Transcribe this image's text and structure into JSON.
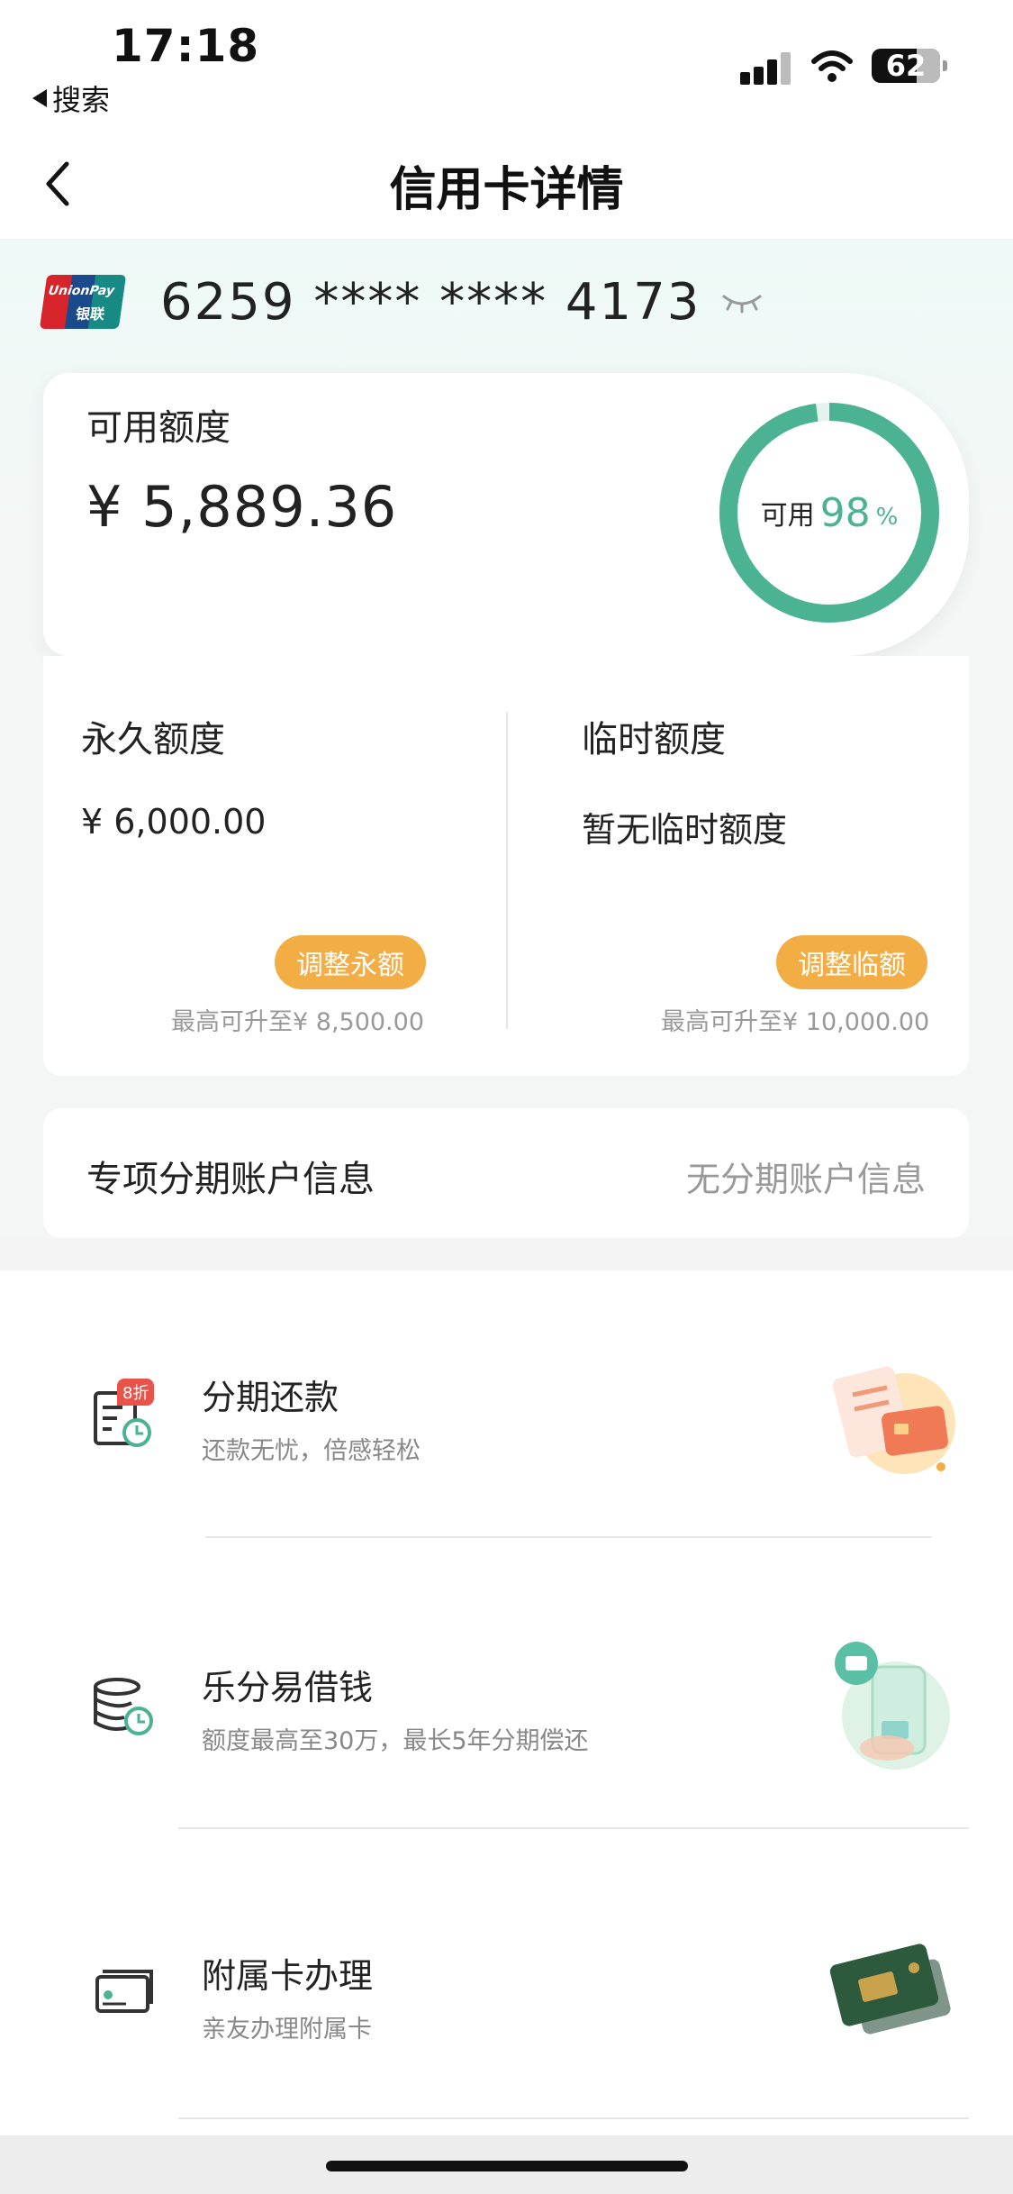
{
  "status_bar": {
    "time": "17:18",
    "back_app": "搜索",
    "battery": "62"
  },
  "nav": {
    "title": "信用卡详情"
  },
  "card": {
    "number": "6259 **** **** 4173",
    "brand_top": "UnionPay",
    "brand_bottom": "银联"
  },
  "available": {
    "label": "可用额度",
    "amount": "¥ 5,889.36",
    "ring_label": "可用",
    "ring_value": "98",
    "ring_unit": "%",
    "ring_fraction": 0.98
  },
  "quota": {
    "permanent": {
      "title": "永久额度",
      "value": "¥ 6,000.00",
      "button": "调整永额",
      "note": "最高可升至¥ 8,500.00"
    },
    "temporary": {
      "title": "临时额度",
      "value": "暂无临时额度",
      "button": "调整临额",
      "note": "最高可升至¥ 10,000.00"
    }
  },
  "installment_account": {
    "label": "专项分期账户信息",
    "value": "无分期账户信息"
  },
  "services": [
    {
      "title": "分期还款",
      "subtitle": "还款无忧，倍感轻松",
      "badge": "8折",
      "icon": "installment-bill-icon"
    },
    {
      "title": "乐分易借钱",
      "subtitle": "额度最高至30万，最长5年分期偿还",
      "icon": "coins-clock-icon"
    },
    {
      "title": "附属卡办理",
      "subtitle": "亲友办理附属卡",
      "icon": "card-icon"
    }
  ],
  "colors": {
    "accent_green": "#4bb393",
    "button_orange": "#f3ad45",
    "badge_red": "#e8534a"
  }
}
